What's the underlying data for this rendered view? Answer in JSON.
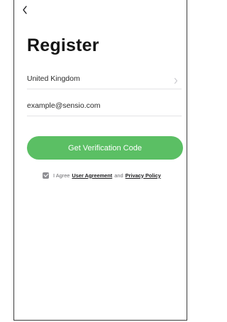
{
  "header": {
    "back_icon": "chevron-left-icon"
  },
  "title": "Register",
  "country": {
    "value": "United Kingdom",
    "chevron_icon": "chevron-right-icon"
  },
  "email": {
    "value": "example@sensio.com"
  },
  "primary_button": {
    "label": "Get Verification Code",
    "color": "#5bbf64"
  },
  "agreement": {
    "checked": true,
    "prefix": "I Agree",
    "user_agreement": "User Agreement",
    "and": "and",
    "privacy_policy": "Privacy Policy"
  }
}
